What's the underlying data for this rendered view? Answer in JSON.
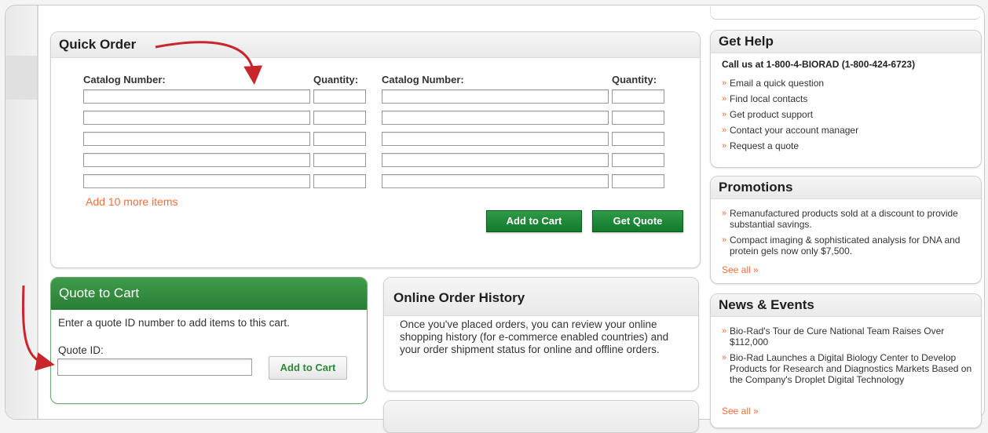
{
  "quick_order": {
    "title": "Quick Order",
    "catalog_header": "Catalog Number:",
    "quantity_header": "Quantity:",
    "add_more": "Add 10 more items",
    "add_to_cart": "Add to Cart",
    "get_quote": "Get Quote"
  },
  "quote_to_cart": {
    "title": "Quote to Cart",
    "description": "Enter a quote ID number to add items to this cart.",
    "quote_label": "Quote ID:",
    "add_to_cart": "Add to Cart"
  },
  "order_history": {
    "title": "Online Order History",
    "description": "Once you've placed orders, you can review your online shopping history (for e-commerce enabled countries) and your order shipment status for online and offline orders."
  },
  "get_help": {
    "title": "Get Help",
    "call": "Call us at 1-800-4-BIORAD (1-800-424-6723)",
    "links": [
      "Email a quick question",
      "Find local contacts",
      "Get product support",
      "Contact your account manager",
      "Request a quote"
    ]
  },
  "promotions": {
    "title": "Promotions",
    "items": [
      "Remanufactured products sold at a discount to provide substantial savings.",
      "Compact imaging & sophisticated analysis for DNA and protein gels now only $7,500."
    ],
    "see_all": "See all »"
  },
  "news": {
    "title": "News & Events",
    "items": [
      "Bio-Rad's Tour de Cure National Team Raises Over $112,000",
      "Bio-Rad Launches a Digital Biology Center to Develop Products for Research and Diagnostics Markets Based on the Company's Droplet Digital Technology"
    ],
    "see_all": "See all »"
  },
  "colors": {
    "accent_green": "#1f8a38",
    "link_orange": "#f0703a",
    "arrow_red": "#c7262b"
  }
}
